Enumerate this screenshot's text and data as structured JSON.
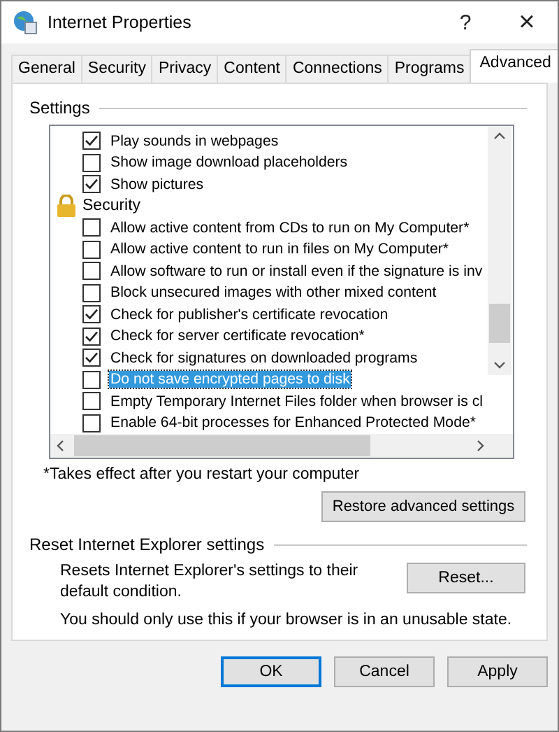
{
  "window": {
    "title": "Internet Properties",
    "help": "?",
    "close": "×"
  },
  "tabs": [
    {
      "label": "General",
      "selected": false
    },
    {
      "label": "Security",
      "selected": false
    },
    {
      "label": "Privacy",
      "selected": false
    },
    {
      "label": "Content",
      "selected": false
    },
    {
      "label": "Connections",
      "selected": false
    },
    {
      "label": "Programs",
      "selected": false
    },
    {
      "label": "Advanced",
      "selected": true
    }
  ],
  "settings": {
    "label": "Settings",
    "items": [
      {
        "kind": "checkbox",
        "label": "Play sounds in webpages",
        "checked": true,
        "selected": false
      },
      {
        "kind": "checkbox",
        "label": "Show image download placeholders",
        "checked": false,
        "selected": false
      },
      {
        "kind": "checkbox",
        "label": "Show pictures",
        "checked": true,
        "selected": false
      },
      {
        "kind": "group",
        "label": "Security"
      },
      {
        "kind": "checkbox",
        "label": "Allow active content from CDs to run on My Computer*",
        "checked": false,
        "selected": false
      },
      {
        "kind": "checkbox",
        "label": "Allow active content to run in files on My Computer*",
        "checked": false,
        "selected": false
      },
      {
        "kind": "checkbox",
        "label": "Allow software to run or install even if the signature is inv",
        "checked": false,
        "selected": false
      },
      {
        "kind": "checkbox",
        "label": "Block unsecured images with other mixed content",
        "checked": false,
        "selected": false
      },
      {
        "kind": "checkbox",
        "label": "Check for publisher's certificate revocation",
        "checked": true,
        "selected": false
      },
      {
        "kind": "checkbox",
        "label": "Check for server certificate revocation*",
        "checked": true,
        "selected": false
      },
      {
        "kind": "checkbox",
        "label": "Check for signatures on downloaded programs",
        "checked": true,
        "selected": false
      },
      {
        "kind": "checkbox",
        "label": "Do not save encrypted pages to disk",
        "checked": false,
        "selected": true
      },
      {
        "kind": "checkbox",
        "label": "Empty Temporary Internet Files folder when browser is cl",
        "checked": false,
        "selected": false
      },
      {
        "kind": "checkbox",
        "label": "Enable 64-bit processes for Enhanced Protected Mode*",
        "checked": false,
        "selected": false
      }
    ],
    "footnote": "*Takes effect after you restart your computer",
    "restore_button": "Restore advanced settings"
  },
  "reset": {
    "label": "Reset Internet Explorer settings",
    "description": "Resets Internet Explorer's settings to their default condition.",
    "button": "Reset...",
    "warning": "You should only use this if your browser is in an unusable state."
  },
  "buttons": [
    {
      "label": "OK",
      "default": true
    },
    {
      "label": "Cancel",
      "default": false
    },
    {
      "label": "Apply",
      "default": false
    }
  ]
}
